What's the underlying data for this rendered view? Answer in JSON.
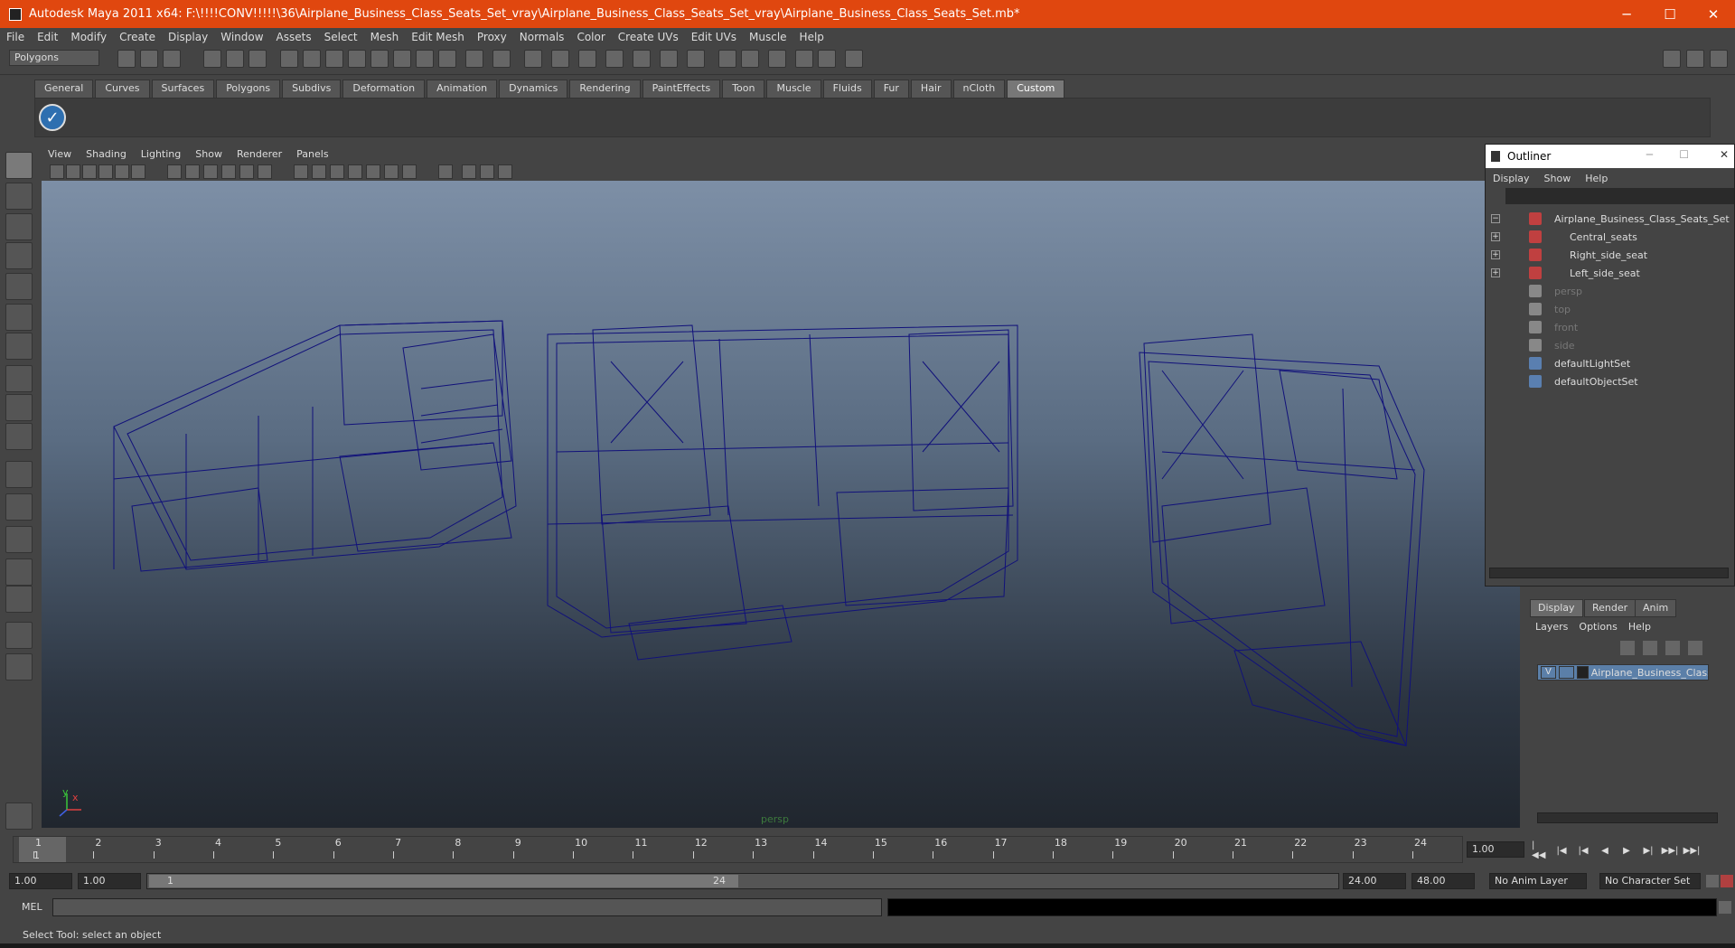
{
  "window": {
    "title": "Autodesk Maya 2011 x64: F:\\!!!!CONV!!!!!\\36\\Airplane_Business_Class_Seats_Set_vray\\Airplane_Business_Class_Seats_Set_vray\\Airplane_Business_Class_Seats_Set.mb*",
    "minimize": "─",
    "maximize": "☐",
    "close": "✕"
  },
  "menus": [
    "File",
    "Edit",
    "Modify",
    "Create",
    "Display",
    "Window",
    "Assets",
    "Select",
    "Mesh",
    "Edit Mesh",
    "Proxy",
    "Normals",
    "Color",
    "Create UVs",
    "Edit UVs",
    "Muscle",
    "Help"
  ],
  "mode_select": "Polygons",
  "shelf_tabs": [
    "General",
    "Curves",
    "Surfaces",
    "Polygons",
    "Subdivs",
    "Deformation",
    "Animation",
    "Dynamics",
    "Rendering",
    "PaintEffects",
    "Toon",
    "Muscle",
    "Fluids",
    "Fur",
    "Hair",
    "nCloth",
    "Custom"
  ],
  "active_shelf": "Custom",
  "viewport": {
    "menus": [
      "View",
      "Shading",
      "Lighting",
      "Show",
      "Renderer",
      "Panels"
    ],
    "camera": "persp",
    "axis_y": "y",
    "axis_x": "x"
  },
  "outliner": {
    "title": "Outliner",
    "menus": [
      "Display",
      "Show",
      "Help"
    ],
    "items": [
      {
        "label": "Airplane_Business_Class_Seats_Set",
        "expander": "−",
        "icon": "mesh-group-icon",
        "dim": false
      },
      {
        "label": "Central_seats",
        "expander": "+",
        "icon": "mesh-group-icon",
        "dim": false
      },
      {
        "label": "Right_side_seat",
        "expander": "+",
        "icon": "mesh-group-icon",
        "dim": false
      },
      {
        "label": "Left_side_seat",
        "expander": "+",
        "icon": "mesh-group-icon",
        "dim": false
      },
      {
        "label": "persp",
        "expander": "",
        "icon": "camera-icon",
        "dim": true
      },
      {
        "label": "top",
        "expander": "",
        "icon": "camera-icon",
        "dim": true
      },
      {
        "label": "front",
        "expander": "",
        "icon": "camera-icon",
        "dim": true
      },
      {
        "label": "side",
        "expander": "",
        "icon": "camera-icon",
        "dim": true
      },
      {
        "label": "defaultLightSet",
        "expander": "",
        "icon": "set-icon",
        "dim": false
      },
      {
        "label": "defaultObjectSet",
        "expander": "",
        "icon": "set-icon",
        "dim": false
      }
    ]
  },
  "layers": {
    "tabs": [
      "Display",
      "Render",
      "Anim"
    ],
    "menus": [
      "Layers",
      "Options",
      "Help"
    ],
    "layer_name": "Airplane_Business_Class_",
    "visible": "V"
  },
  "timeline": {
    "ticks": [
      "1",
      "2",
      "3",
      "4",
      "5",
      "6",
      "7",
      "8",
      "9",
      "10",
      "11",
      "12",
      "13",
      "14",
      "15",
      "16",
      "17",
      "18",
      "19",
      "20",
      "21",
      "22",
      "23",
      "24"
    ],
    "current_frame": "1",
    "current_time": "1.00"
  },
  "range": {
    "start": "1.00",
    "playback_start": "1.00",
    "slider_start": "1",
    "slider_end": "24",
    "playback_end": "24.00",
    "end": "48.00",
    "anim_layer": "No Anim Layer",
    "char_set": "No Character Set"
  },
  "playback": [
    "|◀◀",
    "|◀",
    "|◀",
    "◀",
    "▶",
    "▶|",
    "▶▶|",
    "▶▶|"
  ],
  "cmd": {
    "label": "MEL"
  },
  "help_line": "Select Tool: select an object",
  "colors": {
    "titlebar": "#e0470f",
    "wireframe": "#11117a",
    "accent": "#2e6fb0"
  }
}
